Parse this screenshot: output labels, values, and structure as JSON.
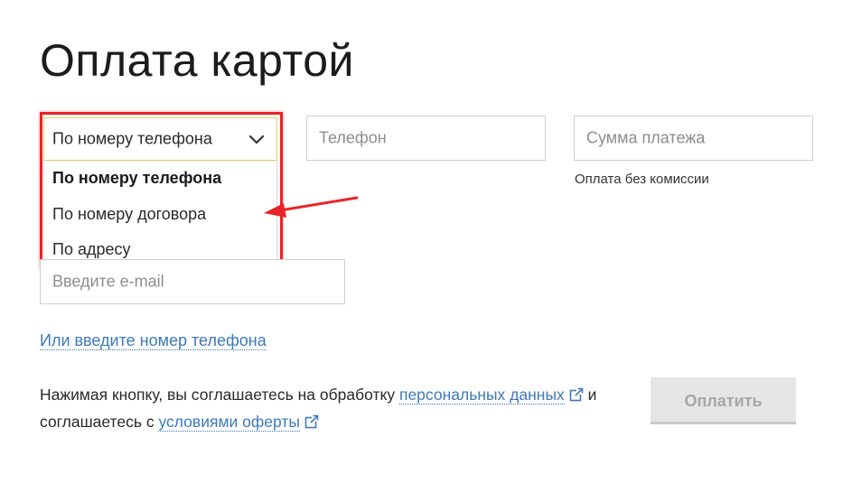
{
  "page": {
    "title": "Оплата картой"
  },
  "form": {
    "method_select": {
      "value": "По номеру телефона",
      "options": [
        "По номеру телефона",
        "По номеру договора",
        "По адресу"
      ]
    },
    "phone_input": {
      "placeholder": "Телефон"
    },
    "amount_input": {
      "placeholder": "Сумма платежа"
    },
    "amount_note": "Оплата без комиссии",
    "email_input": {
      "placeholder": "Введите e-mail"
    },
    "alt_link": "Или введите номер телефона"
  },
  "consent": {
    "line1_prefix": "Нажимая кнопку, вы соглашаетесь на обработку",
    "personal_data_link": "персональных данных",
    "line1_suffix": "и",
    "line2_prefix": "соглашаетесь с",
    "offer_link": "условиями оферты"
  },
  "pay_button": {
    "label": "Оплатить"
  },
  "annotation": {
    "color": "#e8242a"
  },
  "colors": {
    "link": "#3d7ab8",
    "select_border": "#e0cd6a"
  }
}
